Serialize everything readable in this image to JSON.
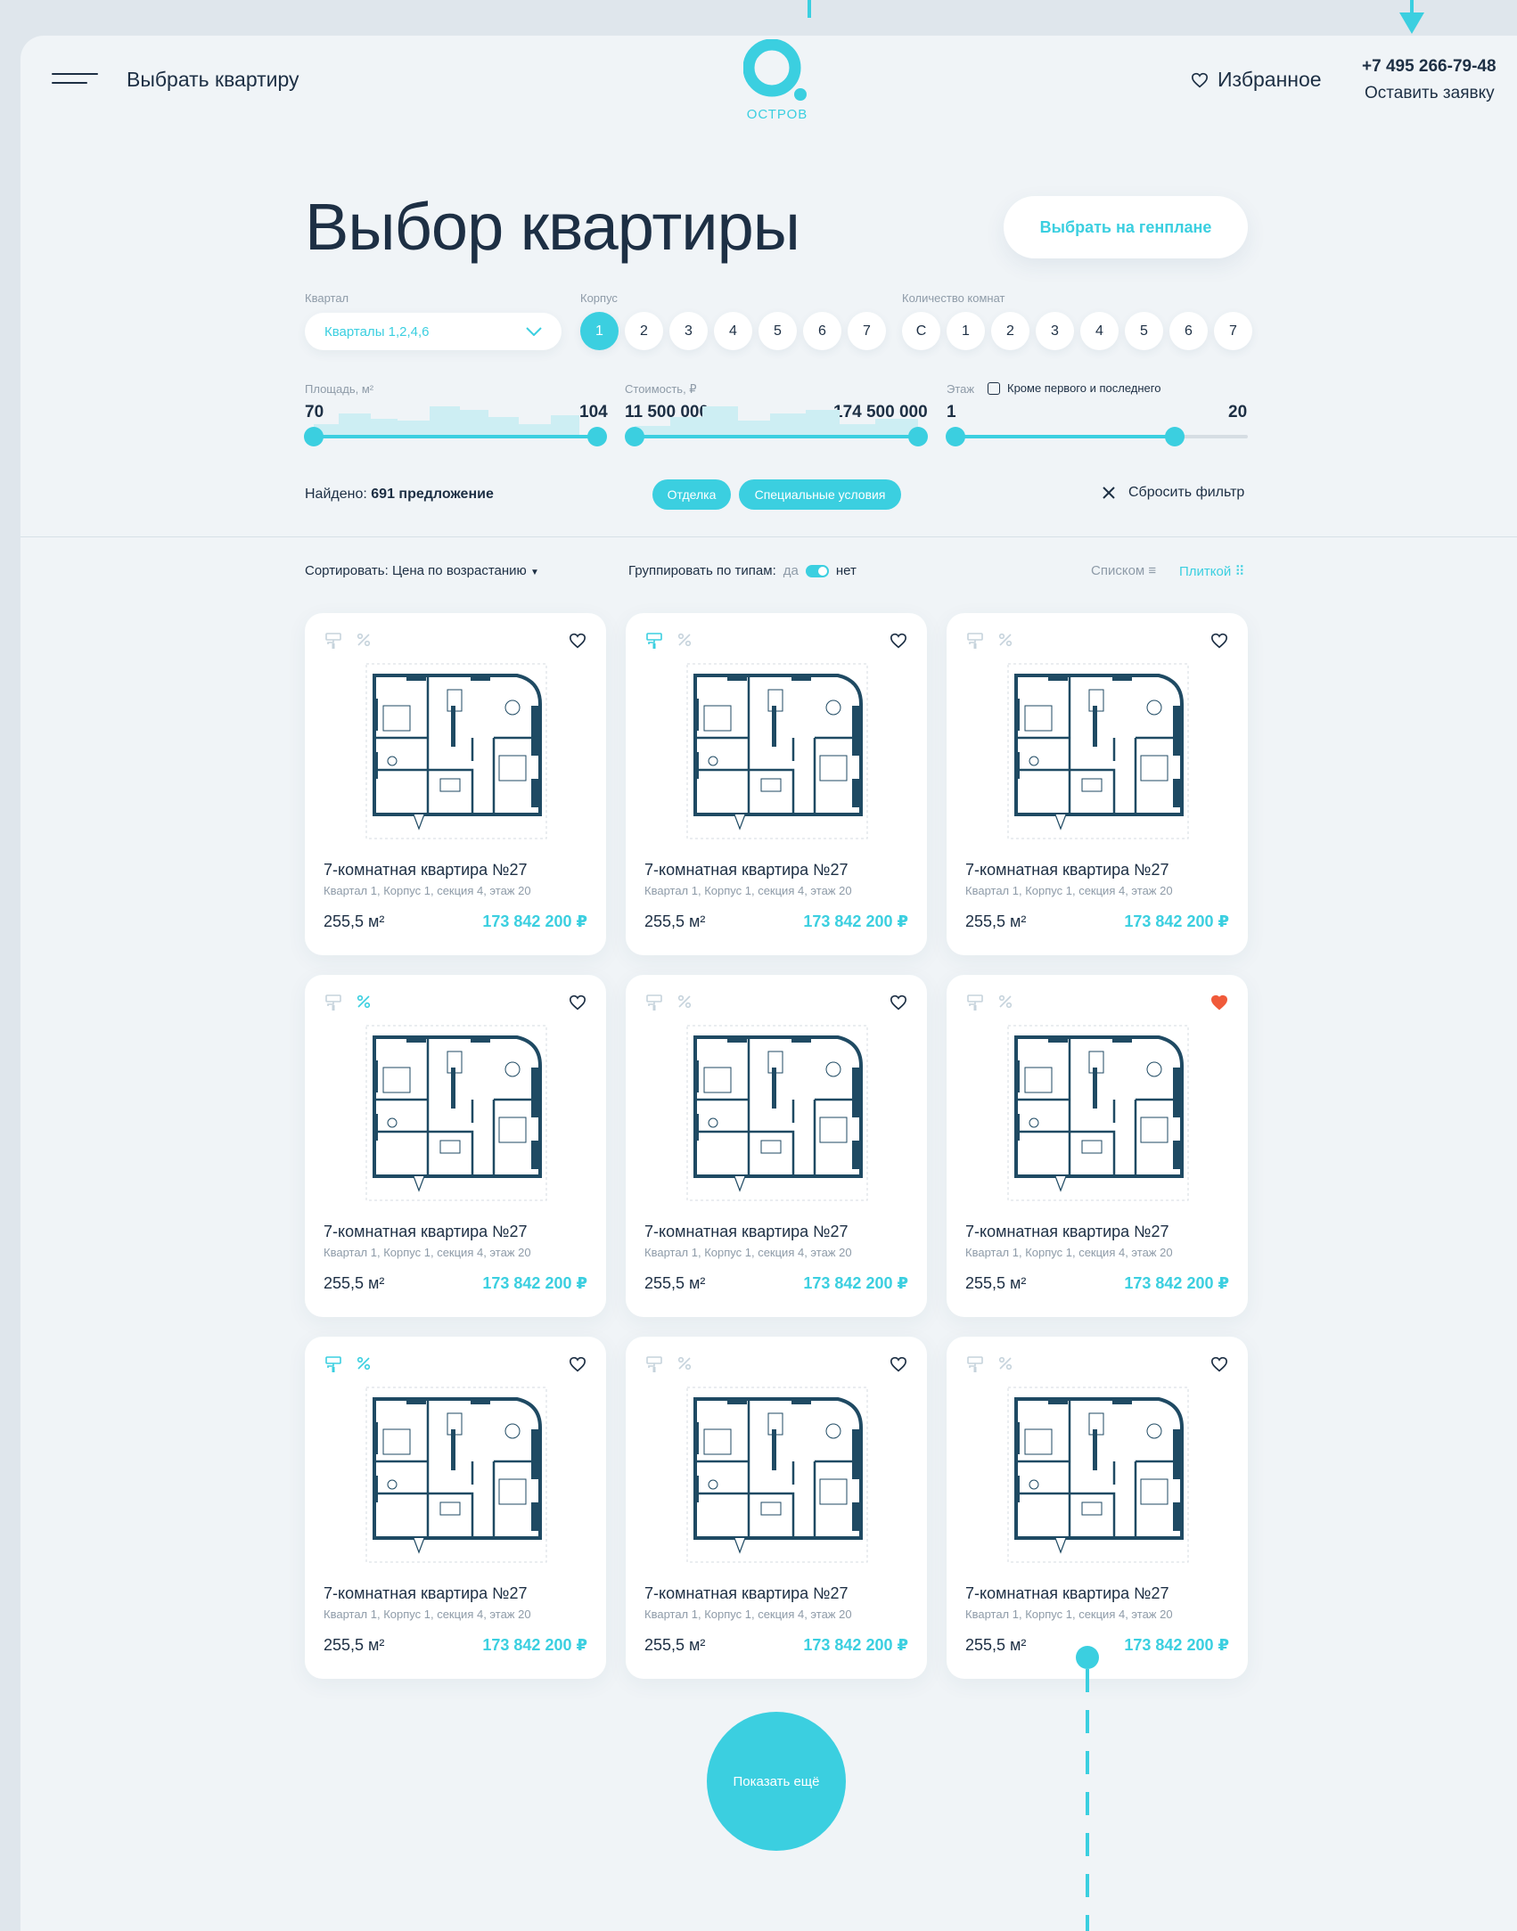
{
  "header": {
    "nav_link": "Выбрать квартиру",
    "logo_text": "ОСТРОВ",
    "favorites": "Избранное",
    "phone": "+7 495 266-79-48",
    "request": "Оставить заявку"
  },
  "page": {
    "title": "Выбор квартиры",
    "genplan_button": "Выбрать на генплане"
  },
  "filters": {
    "quarter_label": "Квартал",
    "quarter_value": "Кварталы 1,2,4,6",
    "building_label": "Корпус",
    "buildings": [
      "1",
      "2",
      "3",
      "4",
      "5",
      "6",
      "7"
    ],
    "rooms_label": "Количество комнат",
    "rooms": [
      "С",
      "1",
      "2",
      "3",
      "4",
      "5",
      "6",
      "7"
    ],
    "area_label": "Площадь, м²",
    "area_min": "70",
    "area_max": "104",
    "price_label": "Стоимость, ₽",
    "price_min": "11 500 000",
    "price_max": "174 500 000",
    "floor_label": "Этаж",
    "floor_exclude": "Кроме первого и последнего",
    "floor_min": "1",
    "floor_max": "20",
    "found_prefix": "Найдено:",
    "found_count": "691 предложение",
    "tag_finish": "Отделка",
    "tag_special": "Специальные условия",
    "reset": "Сбросить фильтр"
  },
  "toolbar": {
    "sort": "Сортировать: Цена по возрастанию",
    "group_label": "Группировать по типам:",
    "group_yes": "да",
    "group_no": "нет",
    "view_list": "Списком",
    "view_tile": "Плиткой"
  },
  "colors": {
    "accent": "#3bcfe0",
    "dark": "#1d2f44",
    "heart_active": "#f05a3a"
  },
  "cards": [
    {
      "name": "7-комнатная квартира №27",
      "address": "Квартал 1, Корпус 1, секция 4, этаж 20",
      "area": "255,5 м²",
      "price": "173 842 200 ₽",
      "finish_active": false,
      "discount_active": false,
      "favorite": false
    },
    {
      "name": "7-комнатная квартира №27",
      "address": "Квартал 1, Корпус 1, секция 4, этаж 20",
      "area": "255,5 м²",
      "price": "173 842 200 ₽",
      "finish_active": true,
      "discount_active": false,
      "favorite": false
    },
    {
      "name": "7-комнатная квартира №27",
      "address": "Квартал 1, Корпус 1, секция 4, этаж 20",
      "area": "255,5 м²",
      "price": "173 842 200 ₽",
      "finish_active": false,
      "discount_active": false,
      "favorite": false
    },
    {
      "name": "7-комнатная квартира №27",
      "address": "Квартал 1, Корпус 1, секция 4, этаж 20",
      "area": "255,5 м²",
      "price": "173 842 200 ₽",
      "finish_active": false,
      "discount_active": true,
      "favorite": false
    },
    {
      "name": "7-комнатная квартира №27",
      "address": "Квартал 1, Корпус 1, секция 4, этаж 20",
      "area": "255,5 м²",
      "price": "173 842 200 ₽",
      "finish_active": false,
      "discount_active": false,
      "favorite": false
    },
    {
      "name": "7-комнатная квартира №27",
      "address": "Квартал 1, Корпус 1, секция 4, этаж 20",
      "area": "255,5 м²",
      "price": "173 842 200 ₽",
      "finish_active": false,
      "discount_active": false,
      "favorite": true
    },
    {
      "name": "7-комнатная квартира №27",
      "address": "Квартал 1, Корпус 1, секция 4, этаж 20",
      "area": "255,5 м²",
      "price": "173 842 200 ₽",
      "finish_active": true,
      "discount_active": true,
      "favorite": false
    },
    {
      "name": "7-комнатная квартира №27",
      "address": "Квартал 1, Корпус 1, секция 4, этаж 20",
      "area": "255,5 м²",
      "price": "173 842 200 ₽",
      "finish_active": false,
      "discount_active": false,
      "favorite": false
    },
    {
      "name": "7-комнатная квартира №27",
      "address": "Квартал 1, Корпус 1, секция 4, этаж 20",
      "area": "255,5 м²",
      "price": "173 842 200 ₽",
      "finish_active": false,
      "discount_active": false,
      "favorite": false
    }
  ],
  "show_more": "Показать ещё"
}
